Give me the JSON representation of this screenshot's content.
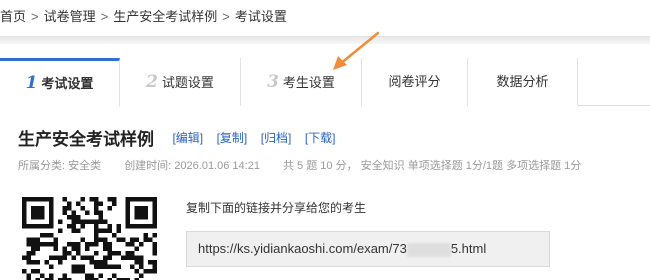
{
  "breadcrumb": {
    "items": [
      "首页",
      "试卷管理",
      "生产安全考试样例",
      "考试设置"
    ],
    "separator": ">"
  },
  "tabs": [
    {
      "num": "1",
      "label": "考试设置",
      "active": true
    },
    {
      "num": "2",
      "label": "试题设置",
      "active": false
    },
    {
      "num": "3",
      "label": "考生设置",
      "active": false
    },
    {
      "num": "",
      "label": "阅卷评分",
      "active": false
    },
    {
      "num": "",
      "label": "数据分析",
      "active": false
    }
  ],
  "exam": {
    "title": "生产安全考试样例",
    "actions": [
      "[编辑]",
      "[复制]",
      "[归档]",
      "[下载]"
    ],
    "category": "所属分类: 安全类",
    "created": "创建时间: 2026.01.06 14:21",
    "summary": "共 5 题 10 分， 安全知识 单项选择题 1分/1题 多项选择题 1分"
  },
  "share": {
    "label": "复制下面的链接并分享给您的考生",
    "url_prefix": "https://ks.yidiankaoshi.com/exam/73",
    "url_suffix": "5.html"
  },
  "colors": {
    "accent": "#2f6fd0",
    "link": "#2a63c8",
    "arrow": "#f28c38"
  }
}
